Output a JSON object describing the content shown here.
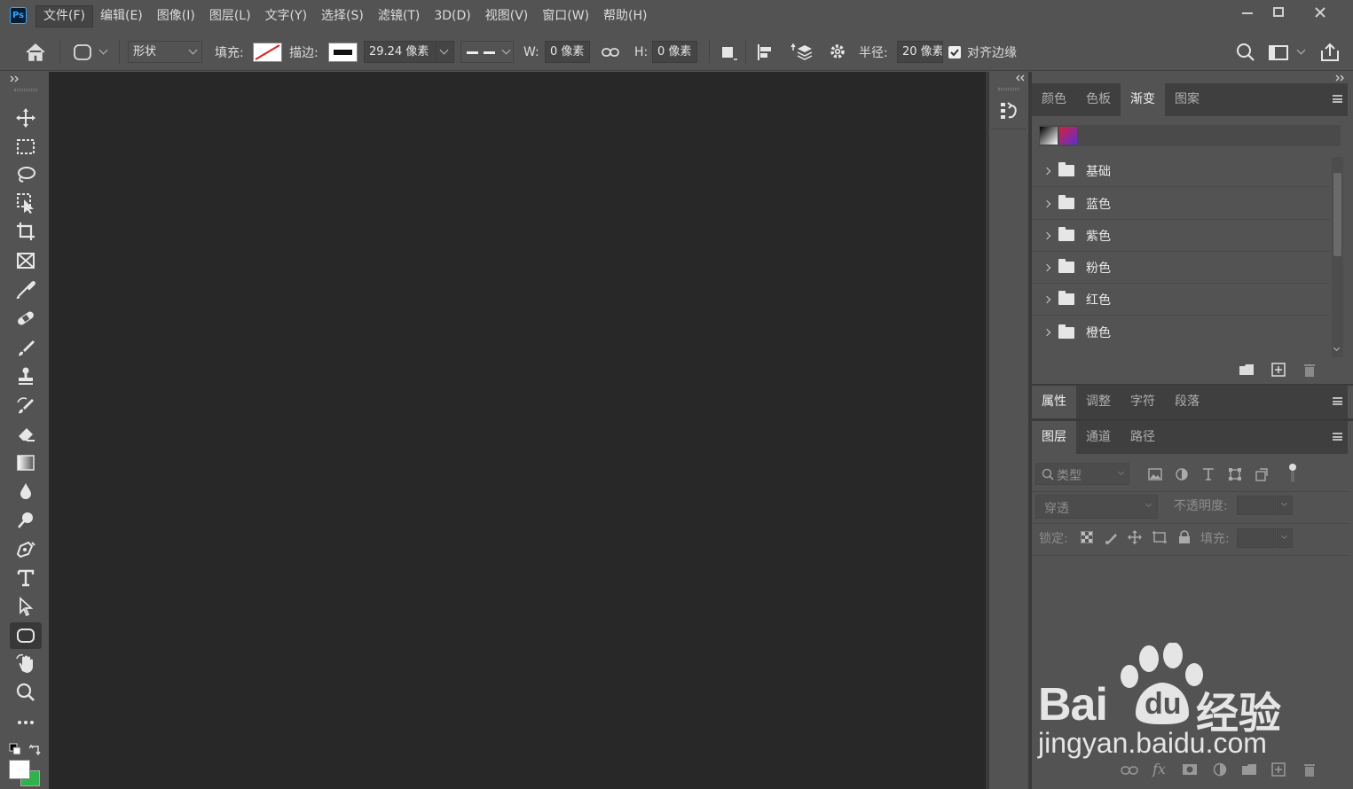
{
  "app": {
    "logo_text": "Ps"
  },
  "menu": {
    "items": [
      "文件(F)",
      "编辑(E)",
      "图像(I)",
      "图层(L)",
      "文字(Y)",
      "选择(S)",
      "滤镜(T)",
      "3D(D)",
      "视图(V)",
      "窗口(W)",
      "帮助(H)"
    ],
    "active_index": 0
  },
  "options": {
    "mode_value": "形状",
    "fill_label": "填充:",
    "stroke_label": "描边:",
    "stroke_width": "29.24 像素",
    "w_label": "W:",
    "w_value": "0 像素",
    "h_label": "H:",
    "h_value": "0 像素",
    "radius_label": "半径:",
    "radius_value": "20 像素",
    "align_edges_label": "对齐边缘",
    "align_edges_checked": true
  },
  "swatches": {
    "foreground": "#ffffff",
    "background": "#2db34a"
  },
  "gradient_panel": {
    "tabs": [
      "颜色",
      "色板",
      "渐变",
      "图案"
    ],
    "active_index": 2,
    "groups": [
      "基础",
      "蓝色",
      "紫色",
      "粉色",
      "红色",
      "橙色"
    ]
  },
  "properties_panel": {
    "tabs": [
      "属性",
      "调整",
      "字符",
      "段落"
    ],
    "active_index": 0
  },
  "layers_panel": {
    "tabs": [
      "图层",
      "通道",
      "路径"
    ],
    "active_index": 0,
    "filter_placeholder": "类型",
    "blend_mode": "穿透",
    "opacity_label": "不透明度:",
    "lock_label": "锁定:",
    "fill_label": "填充:"
  },
  "watermark": {
    "brand_text": "Bai",
    "brand_text2": "du",
    "brand_cn": "经验",
    "url": "jingyan.baidu.com"
  }
}
